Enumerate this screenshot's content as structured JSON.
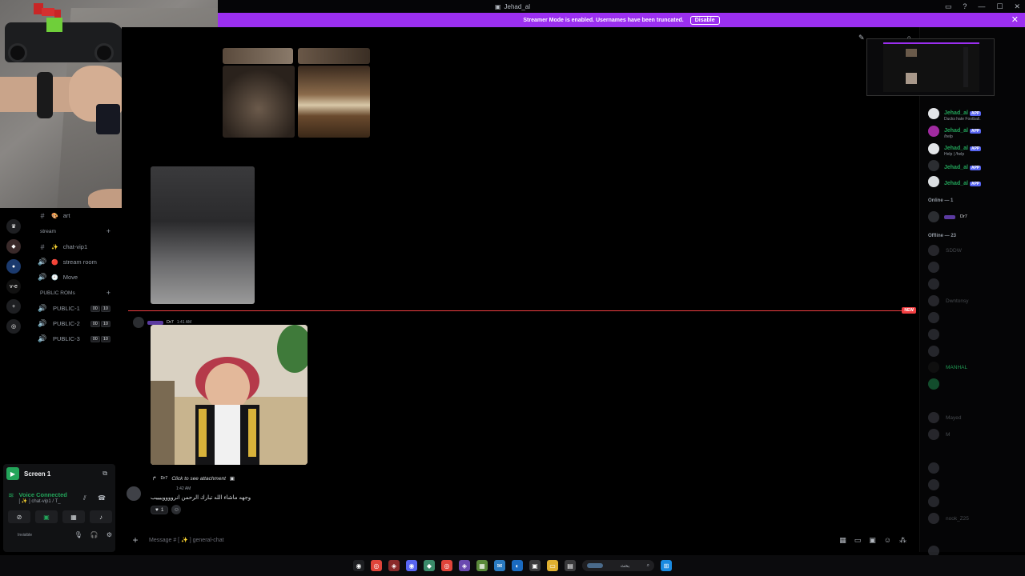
{
  "window": {
    "title": "Jehad_al"
  },
  "banner": {
    "text": "Streamer Mode is enabled. Usernames have been truncated.",
    "disable_label": "Disable",
    "color": "#9b2ff0"
  },
  "channels": {
    "items": [
      {
        "icon": "#",
        "emoji": "🎨",
        "label": "art"
      },
      {
        "type": "category",
        "label": "stream"
      },
      {
        "icon": "#",
        "emoji": "✨",
        "label": "chat-vip1"
      },
      {
        "icon": "🔊",
        "emoji": "🔴",
        "label": "stream room"
      },
      {
        "icon": "🔊",
        "emoji": "🕘",
        "label": "Move"
      },
      {
        "type": "category",
        "label": "PUBLIC ROMs"
      },
      {
        "icon": "🔊",
        "label": "PUBLIC-1",
        "count": "00",
        "limit": "10"
      },
      {
        "icon": "🔊",
        "label": "PUBLIC-2",
        "count": "00",
        "limit": "10"
      },
      {
        "icon": "🔊",
        "label": "PUBLIC-3",
        "count": "00",
        "limit": "10"
      }
    ]
  },
  "voice": {
    "screen_label": "Screen 1",
    "status": "Voice Connected",
    "channel": "[ ✨ ] chat-vip1 / T_",
    "user_status": "Invisible"
  },
  "chat": {
    "new_badge": "NEW",
    "message1": {
      "role": "Dr7",
      "time": "1:41 AM"
    },
    "message2": {
      "role": "Dr7",
      "reply_text": "Click to see attachment",
      "time": "1:42 AM",
      "text": "وجهه ماشاء الله تبارك الرحمن انرووووييييب",
      "reaction_emoji": "♥",
      "reaction_count": "1"
    },
    "composer_placeholder": "Message # [ ✨ ] general-chat"
  },
  "members": {
    "apps": [
      {
        "name": "Jehad_al",
        "badge": "APP",
        "sub": "Ducks hate Football."
      },
      {
        "name": "Jehad_al",
        "badge": "APP",
        "sub": "/help"
      },
      {
        "name": "Jehad_al",
        "badge": "APP",
        "sub": "Help | /help"
      },
      {
        "name": "Jehad_al",
        "badge": "APP",
        "sub": ""
      },
      {
        "name": "Jehad_al",
        "badge": "APP",
        "sub": ""
      }
    ],
    "online_label": "Online — 1",
    "online_role": "Dr7",
    "offline_label": "Offline — 23",
    "offline": [
      "SDDW",
      "",
      "",
      "Dwntonsy",
      "",
      "",
      "",
      "",
      "MANHAL",
      "",
      "",
      "Mayed",
      "M",
      "",
      "",
      "",
      "",
      "nook_Z25"
    ]
  },
  "taskbar": {
    "search_placeholder": "بحث"
  }
}
